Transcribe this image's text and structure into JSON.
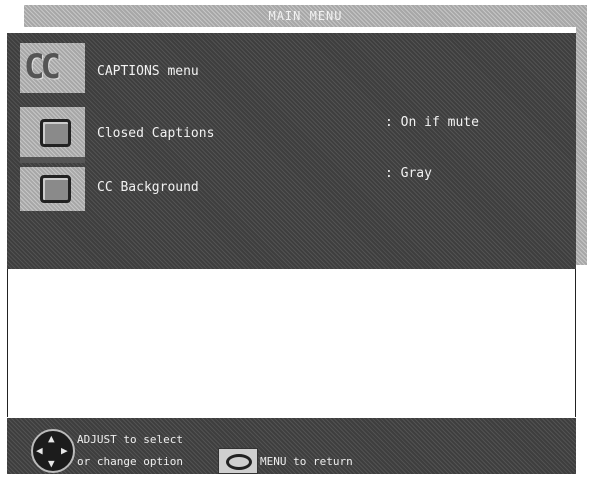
{
  "header": {
    "title": "MAIN MENU"
  },
  "menu": {
    "items": [
      {
        "icon": "cc-icon",
        "label": "CAPTIONS menu",
        "value": ""
      },
      {
        "icon": "monitor-icon",
        "label": "Closed Captions",
        "value": ": On if mute"
      },
      {
        "icon": "monitor-icon",
        "label": "CC Background",
        "value": ": Gray"
      }
    ]
  },
  "footer": {
    "line1": "ADJUST to select",
    "line2": "or change option",
    "menu_hint": "MENU to return",
    "dpad_icon": "dpad-icon",
    "menu_button_icon": "menu-button-icon"
  },
  "colors": {
    "panel": "#3e3e3e",
    "titlebar": "#a7a7a7",
    "text": "#f2f2f2"
  }
}
